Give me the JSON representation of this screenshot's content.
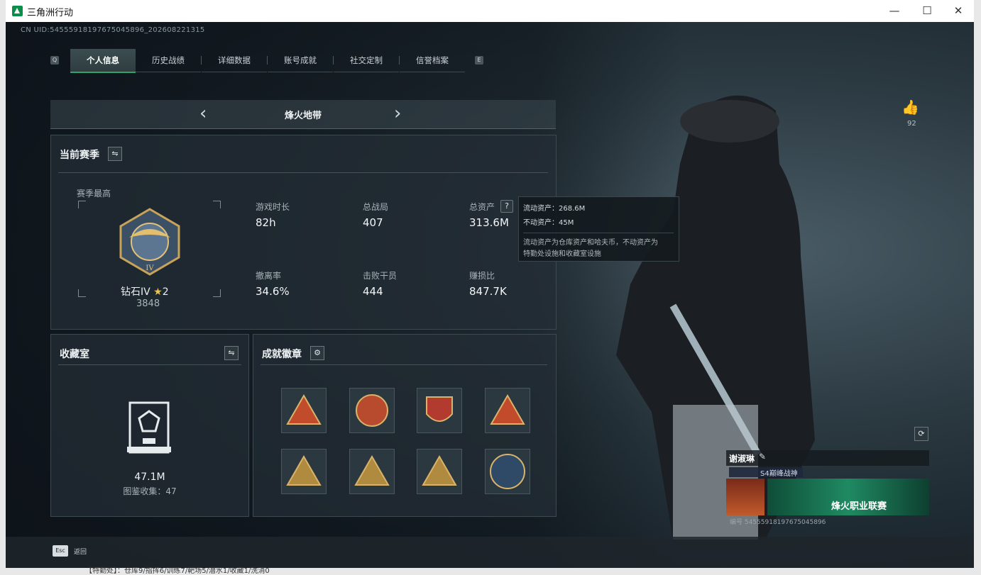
{
  "window": {
    "title": "三角洲行动",
    "minimize": "—",
    "maximize": "☐",
    "close": "✕"
  },
  "uid_text": "CN UID:54555918197675045896_202608221315",
  "tabs": {
    "left_key": "Q",
    "right_key": "E",
    "items": [
      "个人信息",
      "历史战绩",
      "详细数据",
      "账号成就",
      "社交定制",
      "信誉档案"
    ],
    "active_index": 0
  },
  "mode": {
    "label": "烽火地带",
    "prev": "‹",
    "next": "›"
  },
  "season": {
    "title": "当前赛季",
    "highest_label": "赛季最高",
    "rank_name": "钻石IV",
    "rank_stars": "2",
    "rank_points": "3848",
    "stats": [
      {
        "label": "游戏时长",
        "value": "82h"
      },
      {
        "label": "总战局",
        "value": "407"
      },
      {
        "label": "总资产",
        "value": "313.6M"
      },
      {
        "label": "撤离率",
        "value": "34.6%"
      },
      {
        "label": "击败干员",
        "value": "444"
      },
      {
        "label": "赚损比",
        "value": "847.7K"
      }
    ]
  },
  "tooltip": {
    "line1": "流动资产：268.6M",
    "line2": "不动资产：45M",
    "note1": "流动资产为仓库资产和哈夫币，不动资产为",
    "note2": "特勤处设施和收藏室设施"
  },
  "collection": {
    "title": "收藏室",
    "value": "47.1M",
    "subtitle": "图鉴收集：47"
  },
  "achievements": {
    "title": "成就徽章",
    "badges": 8
  },
  "likes": {
    "count": "92"
  },
  "profile": {
    "name": "谢淑琳",
    "title_tag": "S4巅峰战神",
    "banner_text": "烽火职业联赛",
    "id_text": "编号 54555918197675045896"
  },
  "footer": {
    "esc_key": "Esc",
    "back_label": "返回"
  },
  "bottom_text": "【特勤处】：仓库9/指挥6/训练7/靶场5/潜水1/收藏1/洗消0",
  "colors": {
    "accent": "#2ea36b",
    "panel": "#242e36"
  }
}
